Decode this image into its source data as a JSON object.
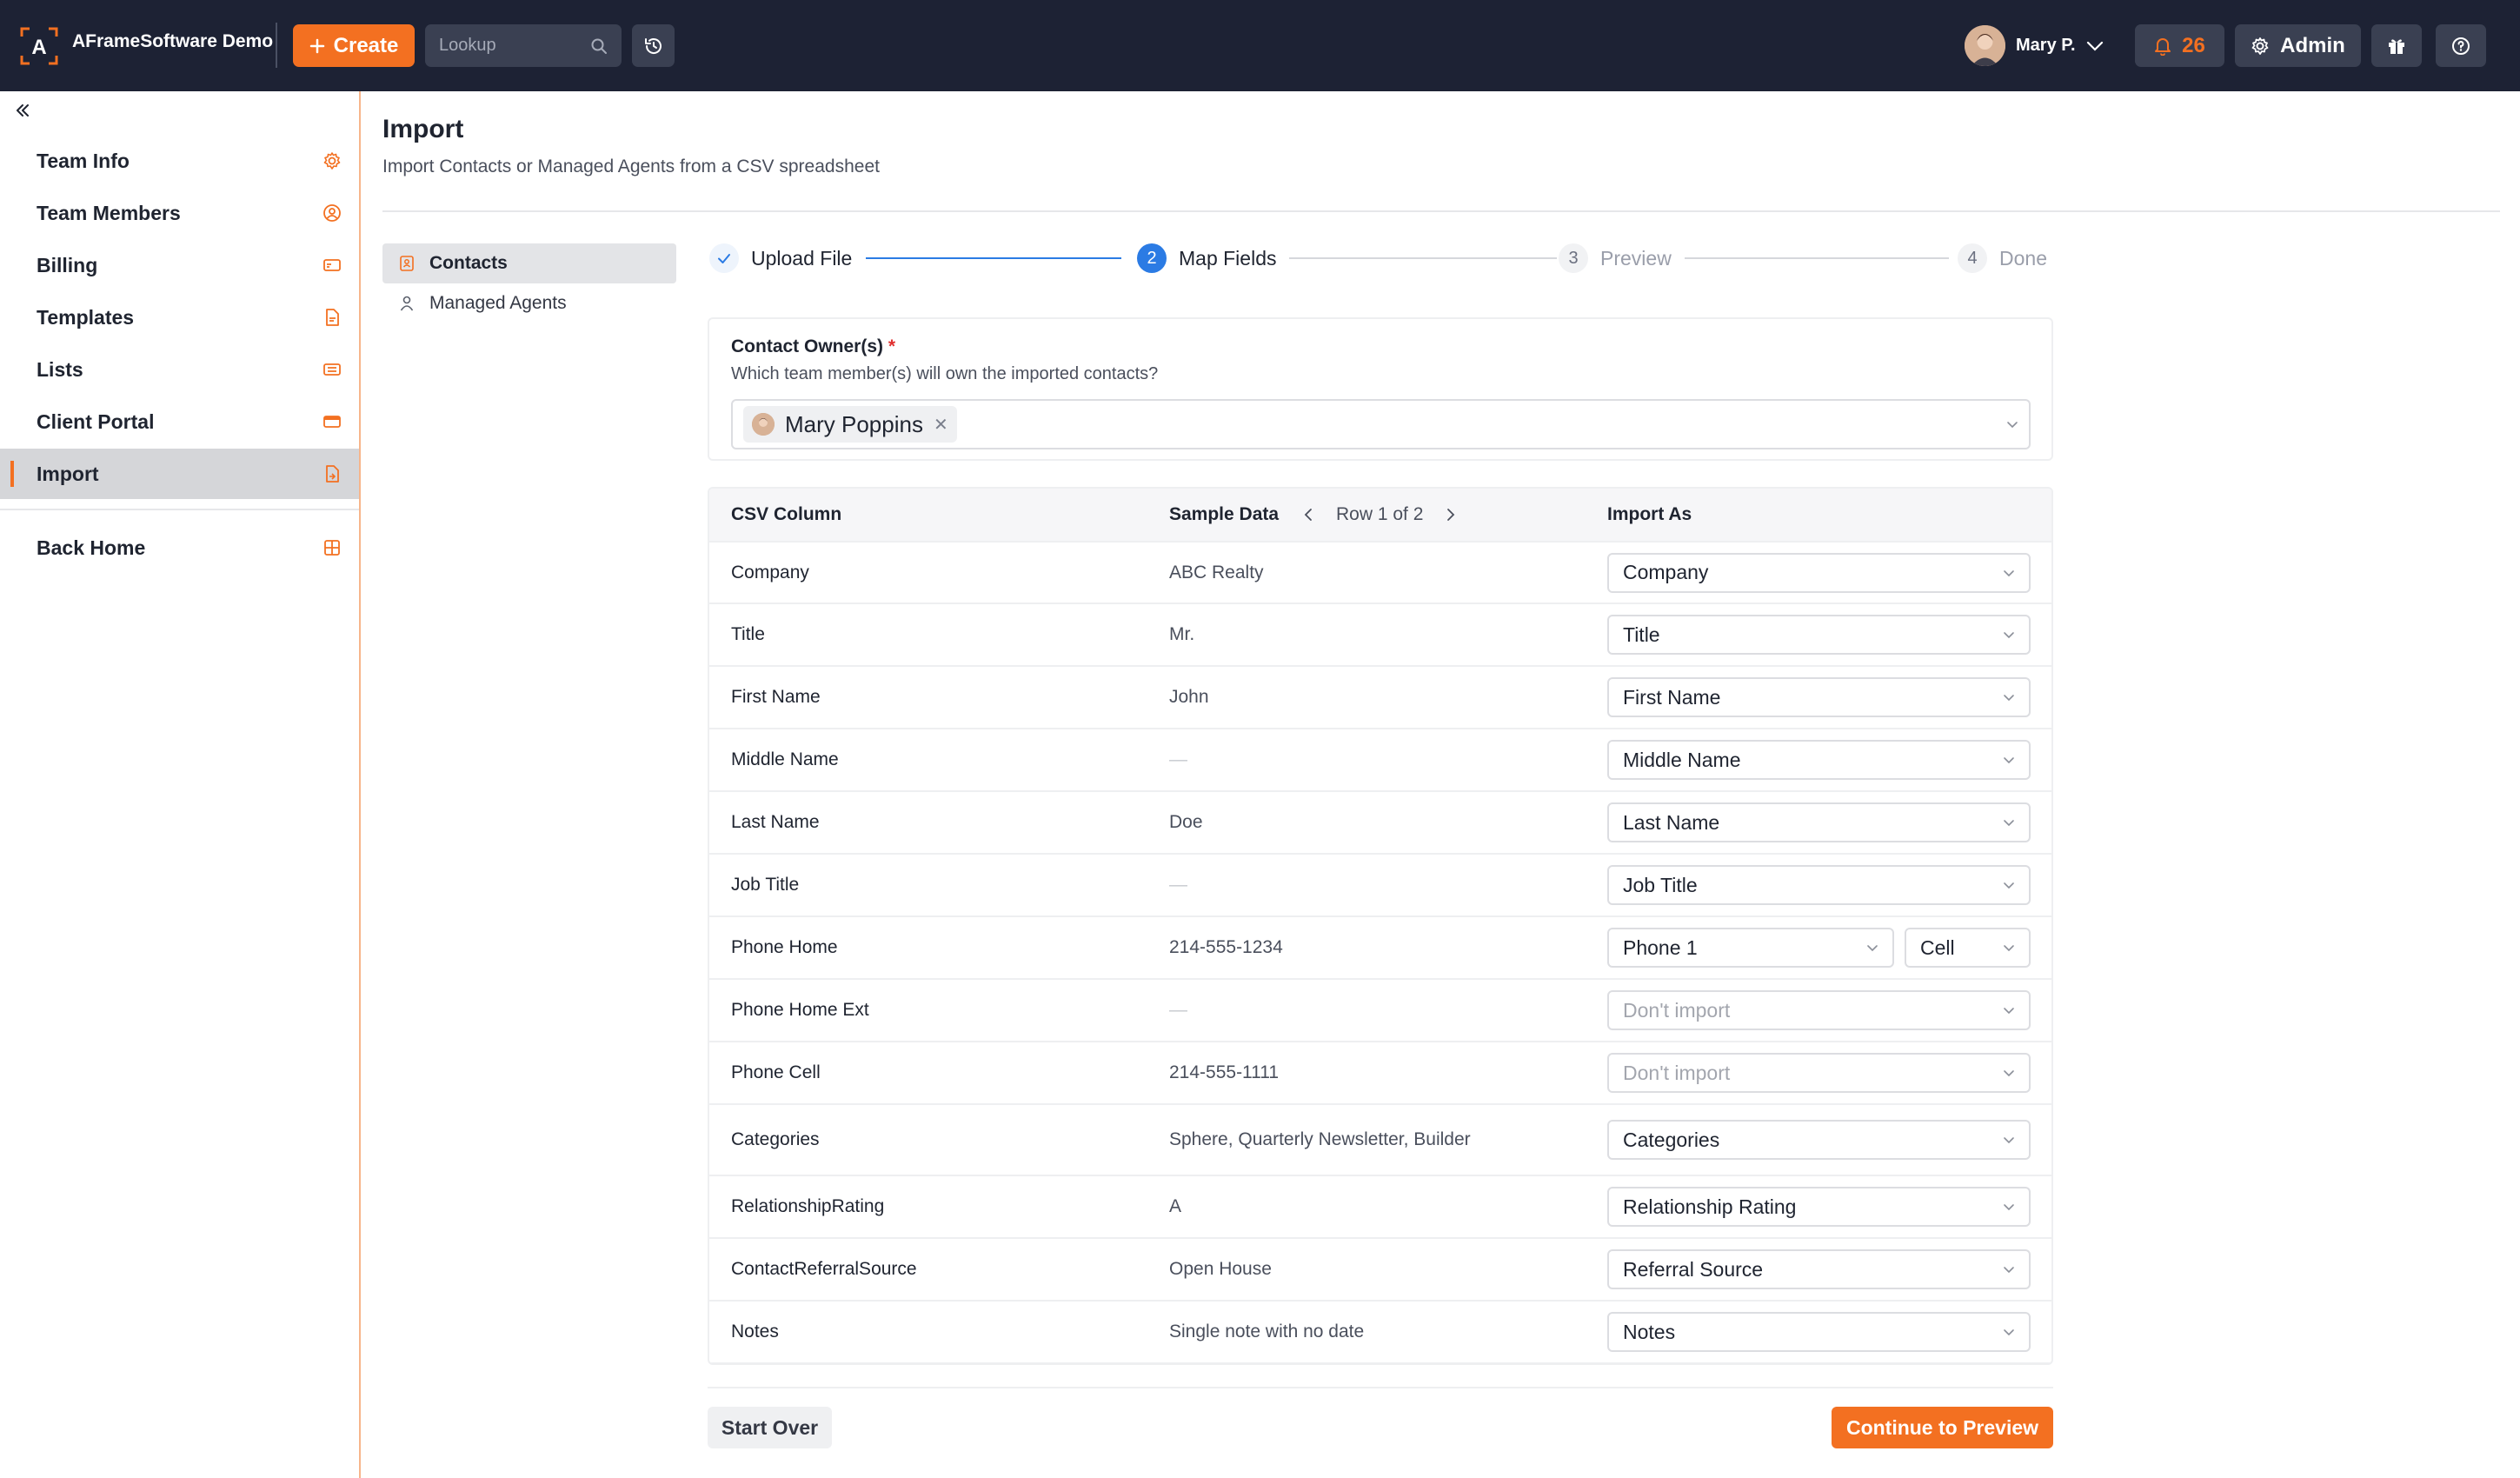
{
  "colors": {
    "topbar": "#1d2234",
    "accent": "#f37021",
    "stepActive": "#2b7be4"
  },
  "header": {
    "brand": "AFrameSoftware Demo",
    "create_label": "Create",
    "lookup_placeholder": "Lookup",
    "user_name": "Mary P.",
    "notif_count": "26",
    "admin_label": "Admin"
  },
  "sidebar": {
    "items": [
      {
        "label": "Team Info",
        "icon": "gear-icon"
      },
      {
        "label": "Team Members",
        "icon": "user-circle-icon"
      },
      {
        "label": "Billing",
        "icon": "credit-card-icon"
      },
      {
        "label": "Templates",
        "icon": "document-icon"
      },
      {
        "label": "Lists",
        "icon": "list-card-icon"
      },
      {
        "label": "Client Portal",
        "icon": "portal-icon"
      },
      {
        "label": "Import",
        "icon": "file-import-icon"
      }
    ],
    "back_home": "Back Home"
  },
  "page": {
    "title": "Import",
    "subtitle": "Import Contacts or Managed Agents from a CSV spreadsheet"
  },
  "subnav": {
    "contacts": "Contacts",
    "managed_agents": "Managed Agents"
  },
  "steps": [
    {
      "num": "1",
      "label": "Upload File",
      "state": "done"
    },
    {
      "num": "2",
      "label": "Map Fields",
      "state": "active"
    },
    {
      "num": "3",
      "label": "Preview",
      "state": "pending"
    },
    {
      "num": "4",
      "label": "Done",
      "state": "pending"
    }
  ],
  "owner": {
    "label": "Contact Owner(s)",
    "required_mark": "*",
    "help": "Which team member(s) will own the imported contacts?",
    "selected": "Mary Poppins"
  },
  "table": {
    "headers": {
      "csv_column": "CSV Column",
      "sample_data": "Sample Data",
      "import_as": "Import As"
    },
    "row_indicator": "Row 1 of 2",
    "rows": [
      {
        "column": "Company",
        "sample": "ABC Realty",
        "import_as": "Company"
      },
      {
        "column": "Title",
        "sample": "Mr.",
        "import_as": "Title"
      },
      {
        "column": "First Name",
        "sample": "John",
        "import_as": "First Name"
      },
      {
        "column": "Middle Name",
        "sample": "—",
        "import_as": "Middle Name"
      },
      {
        "column": "Last Name",
        "sample": "Doe",
        "import_as": "Last Name"
      },
      {
        "column": "Job Title",
        "sample": "—",
        "import_as": "Job Title"
      },
      {
        "column": "Phone Home",
        "sample": "214-555-1234",
        "import_as": "Phone 1",
        "phone_type": "Cell"
      },
      {
        "column": "Phone Home Ext",
        "sample": "—",
        "import_as": "Don't import"
      },
      {
        "column": "Phone Cell",
        "sample": "214-555-1111",
        "import_as": "Don't import"
      },
      {
        "column": "Categories",
        "sample": "Sphere, Quarterly Newsletter, Builder",
        "import_as": "Categories"
      },
      {
        "column": "RelationshipRating",
        "sample": "A",
        "import_as": "Relationship Rating"
      },
      {
        "column": "ContactReferralSource",
        "sample": "Open House",
        "import_as": "Referral Source"
      },
      {
        "column": "Notes",
        "sample": "Single note with no date",
        "import_as": "Notes"
      }
    ]
  },
  "footer": {
    "start_over": "Start Over",
    "continue": "Continue to Preview"
  }
}
